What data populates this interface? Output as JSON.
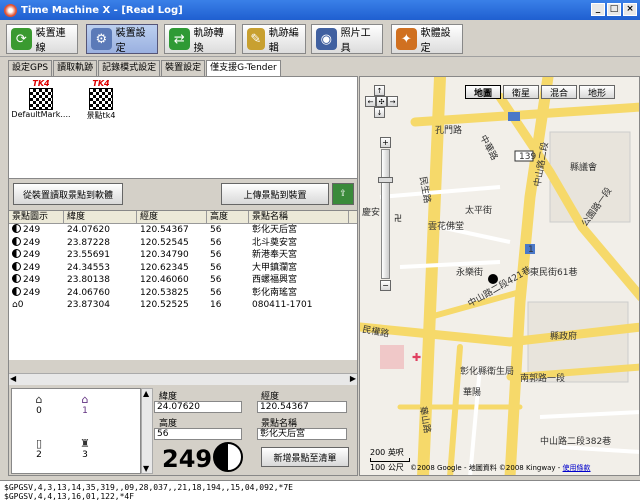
{
  "window": {
    "title": "Time Machine X - [Read Log]"
  },
  "toolbar": [
    {
      "label": "裝置連線",
      "icon": "refresh-icon"
    },
    {
      "label": "裝置設定",
      "icon": "device-settings-icon"
    },
    {
      "label": "軌跡轉換",
      "icon": "convert-icon"
    },
    {
      "label": "軌跡編輯",
      "icon": "edit-track-icon"
    },
    {
      "label": "照片工具",
      "icon": "camera-icon"
    },
    {
      "label": "軟體設定",
      "icon": "software-settings-icon"
    }
  ],
  "tabs": [
    {
      "label": "設定GPS"
    },
    {
      "label": "讀取軌跡"
    },
    {
      "label": "記錄模式設定"
    },
    {
      "label": "裝置設定"
    },
    {
      "label": "僅支援G-Tender"
    }
  ],
  "markers": [
    {
      "name": "DefaultMark....",
      "badge": "TK4"
    },
    {
      "name": "景點tk4",
      "badge": "TK4"
    }
  ],
  "buttons": {
    "read_poi": "從裝置讀取景點到軟體",
    "upload_poi": "上傳景點到裝置",
    "add_poi": "新增景點至清單"
  },
  "table": {
    "headers": [
      "景點圖示",
      "緯度",
      "經度",
      "高度",
      "景點名稱"
    ],
    "rows": [
      [
        "249",
        "24.07620",
        "120.54367",
        "56",
        "彰化天后宮"
      ],
      [
        "249",
        "23.87228",
        "120.52545",
        "56",
        "北斗奠安宮"
      ],
      [
        "249",
        "23.55691",
        "120.34790",
        "56",
        "新港奉天宮"
      ],
      [
        "249",
        "24.34553",
        "120.62345",
        "56",
        "大甲鎮瀾宮"
      ],
      [
        "249",
        "23.80138",
        "120.46060",
        "56",
        "西螺福興宮"
      ],
      [
        "249",
        "24.06760",
        "120.53825",
        "56",
        "彰化南瑤宮"
      ],
      [
        "0",
        "23.87304",
        "120.52525",
        "16",
        "080411-1701"
      ]
    ]
  },
  "icon_grid": [
    {
      "value": "0"
    },
    {
      "value": "1"
    },
    {
      "value": "2"
    },
    {
      "value": "3"
    }
  ],
  "detail": {
    "lat_label": "緯度",
    "lat": "24.07620",
    "lon_label": "經度",
    "lon": "120.54367",
    "alt_label": "高度",
    "alt": "56",
    "name_label": "景點名稱",
    "name": "彰化天后宮",
    "icon_number": "249"
  },
  "map": {
    "types": [
      "地圖",
      "衛星",
      "混合",
      "地形"
    ],
    "labels": [
      "孔門路",
      "中華路",
      "公園路一段",
      "中山路二段",
      "太平街",
      "雲花佛堂",
      "永樂街",
      "東民街61巷",
      "中山路二段421巷",
      "民權路",
      "縣議會",
      "縣政府",
      "南郭路一段",
      "中山路二段382巷",
      "民生路",
      "彰化縣衛生局",
      "華山路",
      "華陽",
      "慶安",
      "139",
      "1"
    ],
    "scale": [
      "200 英呎",
      "100 公尺"
    ],
    "copyright": "©2008 Google - 地圖資料 ©2008 Kingway -",
    "terms": "使用條款"
  },
  "status": {
    "line1": "$GPGSV,4,3,13,14,35,319,,09,28,037,,21,18,194,,15,04,092,*7E",
    "line2": "$GPGSV,4,4,13,16,01,122,*4F"
  }
}
